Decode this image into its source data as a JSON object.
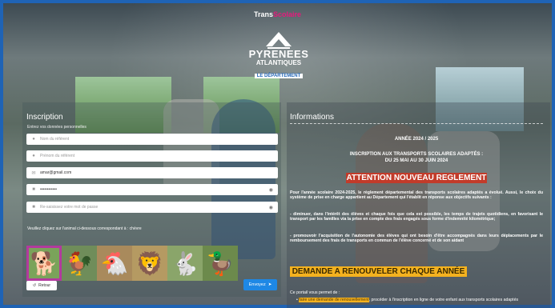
{
  "header": {
    "brand_part1": "Trans",
    "brand_part2": "Scolaire",
    "logo_line1": "PYRENEES",
    "logo_line2": "ATLANTIQUES",
    "logo_line3": "LE DÉPARTEMENT"
  },
  "colors": {
    "accent_pink": "#e7197c",
    "frame_blue": "#1f63b5",
    "attention_red": "#c23b2a",
    "renew_yellow": "#f4b21f",
    "submit_blue": "#1e88e5",
    "selected_border": "#b33a9e"
  },
  "inscription": {
    "title": "Inscription",
    "subtitle": "Entrez vos données personnelles",
    "fields": [
      {
        "icon": "user-icon",
        "placeholder": "Nom du référent",
        "value": ""
      },
      {
        "icon": "user-icon",
        "placeholder": "Prénom du référent",
        "value": ""
      },
      {
        "icon": "email-icon",
        "placeholder": "",
        "value": "amar@gmail.com"
      },
      {
        "icon": "lock-icon",
        "placeholder": "",
        "value": "••••••••••••"
      },
      {
        "icon": "lock-icon",
        "placeholder": "Re-saisissez votre mot de passe",
        "value": ""
      }
    ],
    "hint": "Veuillez cliquez sur l'animal ci-dessous correspondant à : chèvre",
    "animals": [
      "chien",
      "coq",
      "poule",
      "lion",
      "lapin",
      "canard"
    ],
    "selected_animal_index": 0,
    "back_label": "Retour",
    "submit_label": "Envoyez"
  },
  "informations": {
    "title": "Informations",
    "year": "ANNÉE 2024 / 2025",
    "registration_line1": "INSCRIPTION AUX TRANSPORTS SCOLAIRES ADAPTÉS :",
    "registration_line2": "DU 25 MAI AU 30 JUIN 2024",
    "attention": "ATTENTION NOUVEAU REGLEMENT",
    "paragraph1": "Pour l'année scolaire 2024-2025, le règlement départemental des transports scolaires adaptés a évolué. Aussi, le choix du système de prise en charge appartient au Département qui l'établit en réponse aux objectifs suivants :",
    "bullet1": "- diminuer, dans l'intérêt des élèves et chaque fois que cela est possible, les temps de trajets quotidiens, en favorisant le transport par les familles via la prise en compte des frais engagés sous forme d'indemnité kilométrique;",
    "bullet2": "- promouvoir l'acquisition de l'autonomie des élèves qui ont besoin d'être accompagnés dans leurs déplacements par le remboursement des frais de transports en commun de l'élève concerné et de son aidant",
    "renew_banner": "DEMANDE A RENOUVELER CHAQUE ANNÉE",
    "portal_intro": "Ce portail vous permet de :",
    "portal_highlight": "faire une demande de renouvellement",
    "portal_rest": ", procéder à l'inscription en ligne de votre enfant aux transports scolaires adaptés"
  }
}
